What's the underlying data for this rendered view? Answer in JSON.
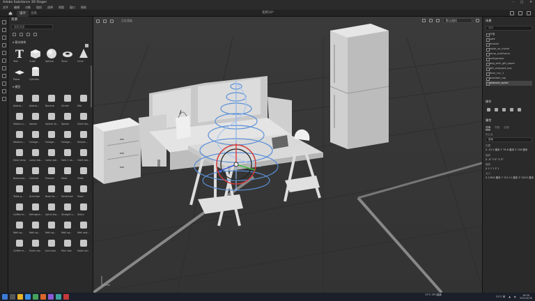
{
  "app": {
    "title": "Adobe Substance 3D Stager",
    "document_title": "名称16*",
    "menu": [
      "文件",
      "编辑",
      "对象",
      "相机",
      "选择",
      "视图",
      "窗口",
      "帮助"
    ],
    "tabs": [
      {
        "label": "设计"
      },
      {
        "label": "渲染"
      }
    ]
  },
  "assets": {
    "header": "资源",
    "search_placeholder": "搜索资源",
    "section_basic": "基本结构",
    "section_models": "模型",
    "basic_items": [
      {
        "label": "Text",
        "icon": "text-icon"
      },
      {
        "label": "Cube",
        "icon": "cube-icon"
      },
      {
        "label": "Sphere",
        "icon": "sphere-icon"
      },
      {
        "label": "Torus",
        "icon": "torus-icon"
      },
      {
        "label": "Cone",
        "icon": "cone-icon"
      },
      {
        "label": "Plane",
        "icon": "plane-icon"
      },
      {
        "label": "Cylinder",
        "icon": "cylinder-icon"
      }
    ],
    "model_items": [
      {
        "label": "Abstra..."
      },
      {
        "label": "Abstra..."
      },
      {
        "label": "Banana"
      },
      {
        "label": "Cinder"
      },
      {
        "label": "Mat"
      },
      {
        "label": "Mobius s..."
      },
      {
        "label": "Splash"
      },
      {
        "label": "Splash sh..."
      },
      {
        "label": "Splash"
      },
      {
        "label": "Cloth tex..."
      },
      {
        "label": "Medium..."
      },
      {
        "label": "Foliage..."
      },
      {
        "label": "Foliage..."
      },
      {
        "label": "Foliage..."
      },
      {
        "label": "Simple..."
      },
      {
        "label": "Desk lamp"
      },
      {
        "label": "Lamp tab..."
      },
      {
        "label": "Lamp wal..."
      },
      {
        "label": "Sofa 1 se..."
      },
      {
        "label": "Cloth tex..."
      },
      {
        "label": "Bookcase..."
      },
      {
        "label": "Cabinet"
      },
      {
        "label": "Dresser"
      },
      {
        "label": "Desk"
      },
      {
        "label": "Table"
      },
      {
        "label": "Table g..."
      },
      {
        "label": "Armchair"
      },
      {
        "label": "Bowl be..."
      },
      {
        "label": "Deckchair"
      },
      {
        "label": "Stool"
      },
      {
        "label": "Coffee m..."
      },
      {
        "label": "Refrigera..."
      },
      {
        "label": "Spiral sta..."
      },
      {
        "label": "Straight s..."
      },
      {
        "label": "Stairs"
      },
      {
        "label": "Wall sq..."
      },
      {
        "label": "Wall sq..."
      },
      {
        "label": "Wall sq..."
      },
      {
        "label": "Wall sq..."
      },
      {
        "label": "Wall wat..."
      },
      {
        "label": "Coffee m..."
      },
      {
        "label": "Drink can"
      },
      {
        "label": "Juice box"
      },
      {
        "label": "Pour box"
      },
      {
        "label": "Soda can"
      }
    ]
  },
  "viewport": {
    "label": "正在渲染",
    "camera": "默认相机"
  },
  "scene": {
    "header": "场景",
    "search_placeholder": "搜索",
    "items": [
      {
        "label": "环境"
      },
      {
        "label": "sofa"
      },
      {
        "label": "dresser"
      },
      {
        "label": "table_no_inside"
      },
      {
        "label": "lamp_wireframe"
      },
      {
        "label": "refrigerator"
      },
      {
        "label": "bag_with_gift_paper"
      },
      {
        "label": "gift_wrapped_box"
      },
      {
        "label": "floor_cnc_1"
      },
      {
        "label": "baseball_cap"
      },
      {
        "label": "abstract_spiral"
      }
    ],
    "selected_index": 10
  },
  "actions": {
    "header": "操作"
  },
  "properties": {
    "header": "属性",
    "subtabs": [
      "变换",
      "材质",
      "纹理"
    ],
    "pivot_label": "中心点",
    "pivot_value": "自动",
    "position_label": "位置",
    "position": "X -51.5 厘米  Y 76.6 厘米  Z 226 厘米",
    "rotation_label": "旋转",
    "rotation": "X -0°  Y 0°  Z 0°",
    "scale_label": "缩放",
    "scale": "X 1  Y 1  Z 1",
    "size_label": "大小",
    "size": "X 128.8 厘米  Y 121.11 厘米  Z 128.5 厘米"
  },
  "taskbar": {
    "weather": "31°C 晴",
    "time": "16:30",
    "date": "2021/5/30",
    "cpu": "13°C CPU温度"
  },
  "colors": {
    "accent": "#4a8fe0",
    "spiral": "#5a8fd6",
    "gizmo_x": "#e04040",
    "gizmo_y": "#40c040",
    "gizmo_z": "#4060e0"
  }
}
